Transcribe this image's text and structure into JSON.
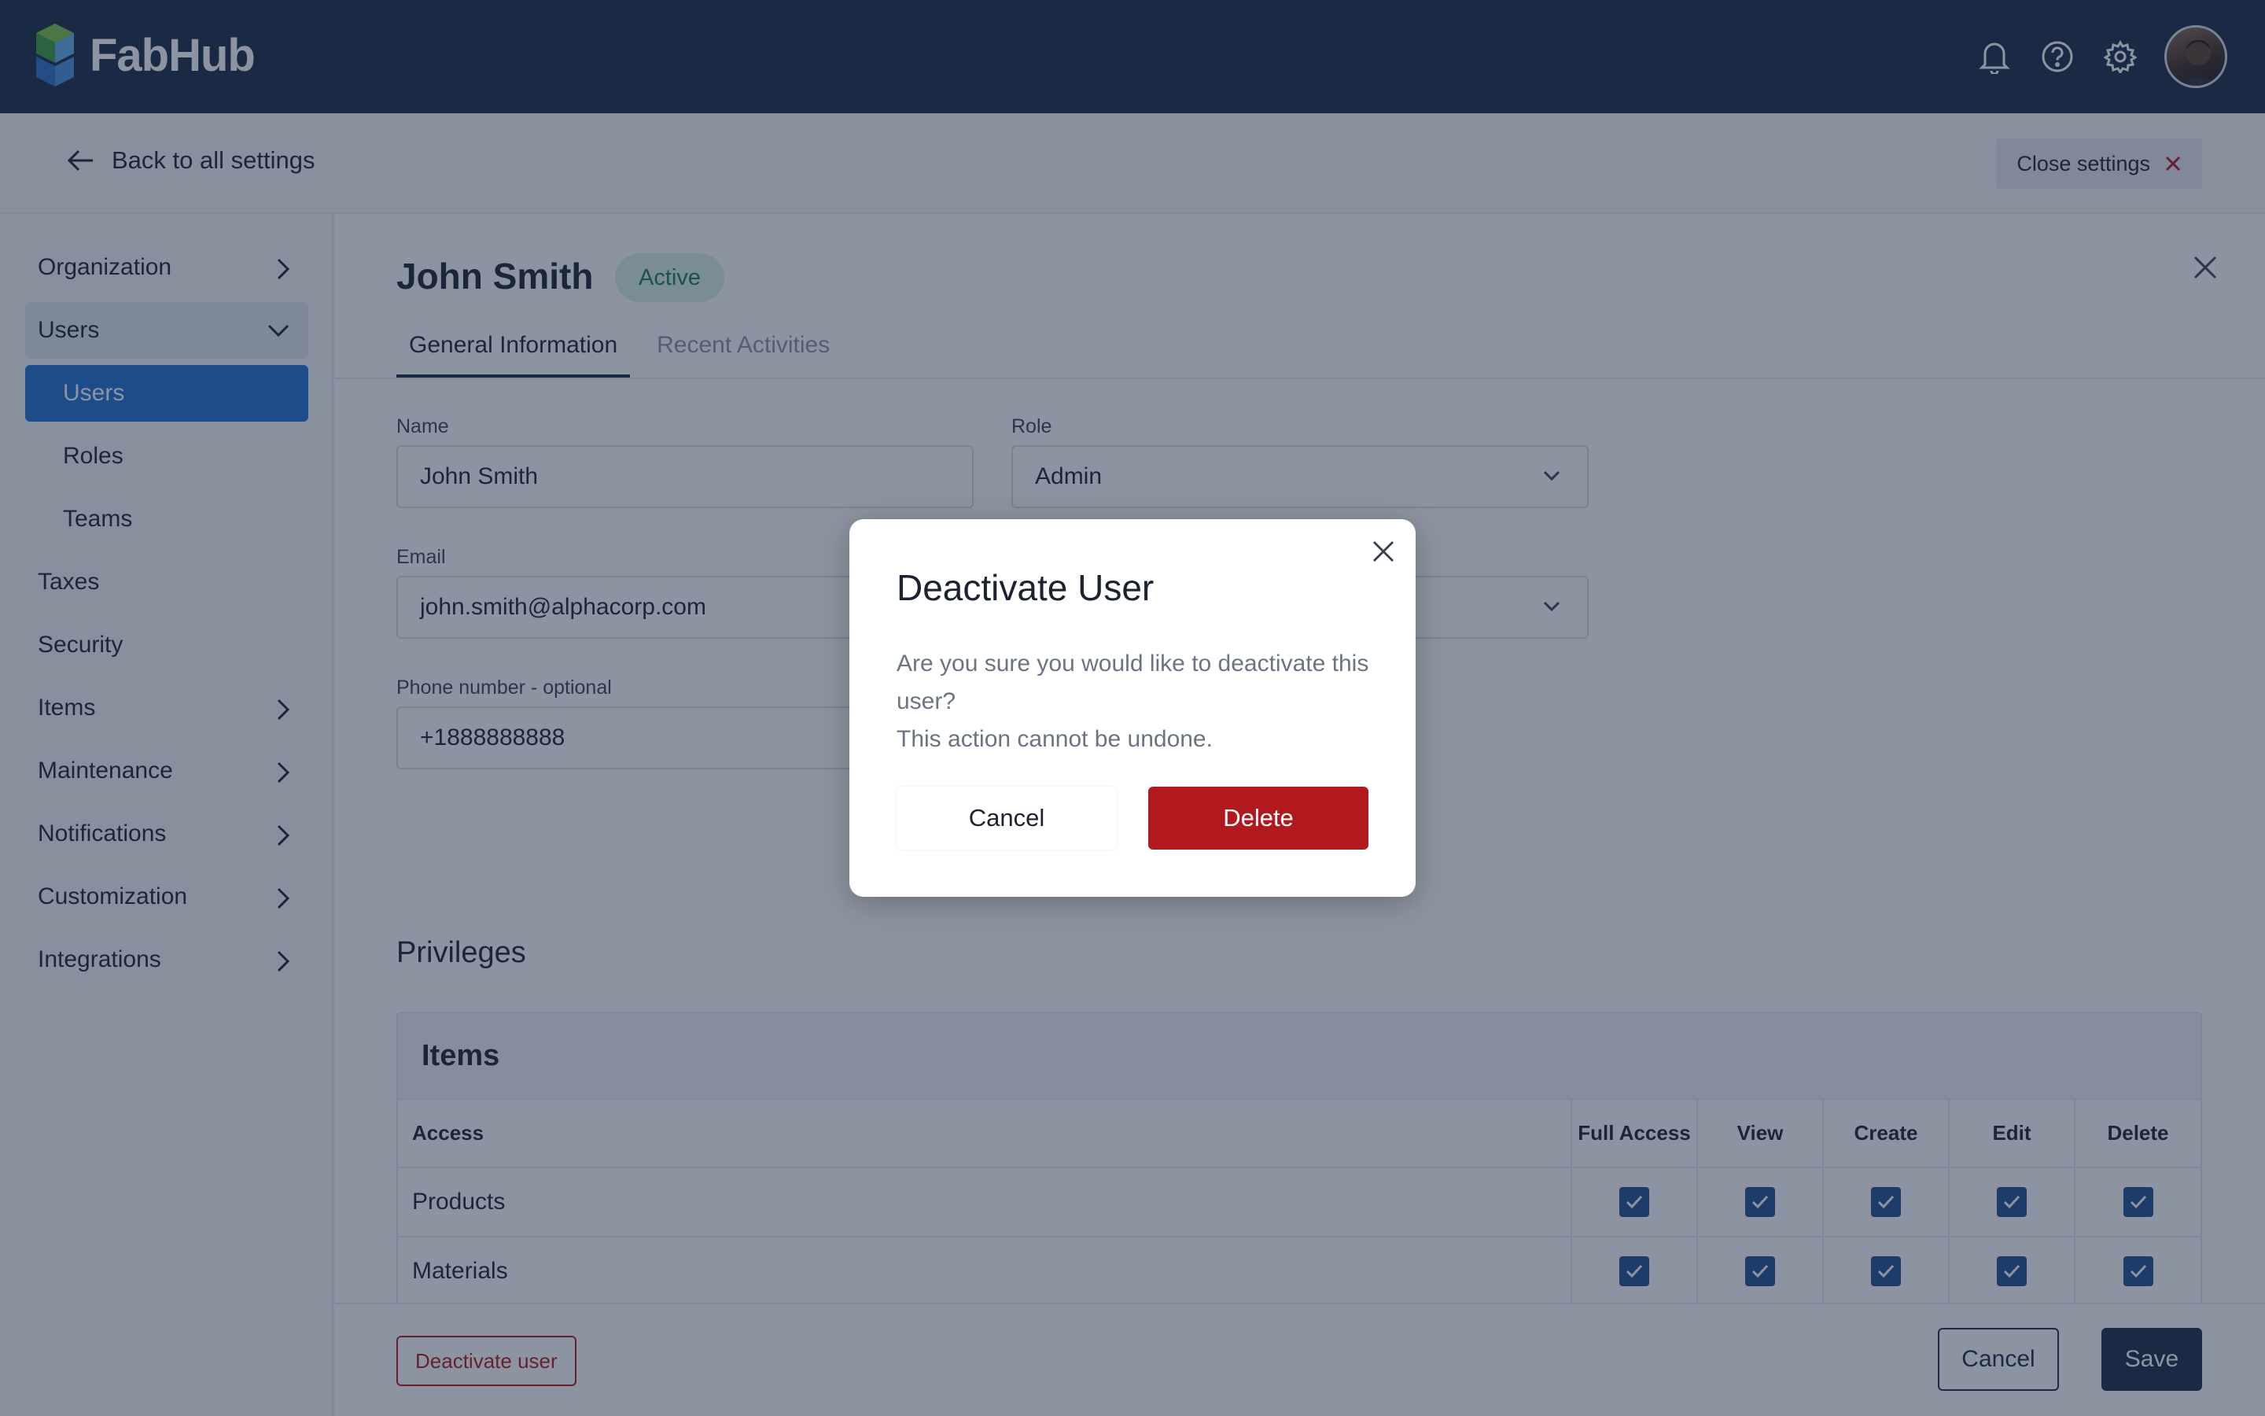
{
  "app": {
    "name": "FabHub"
  },
  "header": {
    "icons": [
      "bell-icon",
      "help-icon",
      "gear-icon"
    ],
    "back_label": "Back to all settings",
    "close_settings_label": "Close settings"
  },
  "sidebar": {
    "items": [
      {
        "label": "Organization",
        "expandable": true
      },
      {
        "label": "Users",
        "expanded": true
      },
      {
        "label": "Users",
        "sub": true,
        "selected": true
      },
      {
        "label": "Roles",
        "sub": true
      },
      {
        "label": "Teams",
        "sub": true
      },
      {
        "label": "Taxes"
      },
      {
        "label": "Security"
      },
      {
        "label": "Items",
        "expandable": true
      },
      {
        "label": "Maintenance",
        "expandable": true
      },
      {
        "label": "Notifications",
        "expandable": true
      },
      {
        "label": "Customization",
        "expandable": true
      },
      {
        "label": "Integrations",
        "expandable": true
      }
    ]
  },
  "user": {
    "name": "John Smith",
    "status": "Active"
  },
  "tabs": [
    {
      "label": "General Information",
      "active": true
    },
    {
      "label": "Recent Activities",
      "active": false
    }
  ],
  "form": {
    "name_label": "Name",
    "name_value": "John Smith",
    "role_label": "Role",
    "role_value": "Admin",
    "email_label": "Email",
    "email_value": "john.smith@alphacorp.com",
    "phone_label": "Phone number - optional",
    "phone_value": "+1888888888"
  },
  "privileges": {
    "title": "Privileges",
    "section": "Items",
    "columns": [
      "Access",
      "Full Access",
      "View",
      "Create",
      "Edit",
      "Delete"
    ],
    "rows": [
      {
        "name": "Products",
        "checks": [
          true,
          true,
          true,
          true,
          true
        ]
      },
      {
        "name": "Materials",
        "checks": [
          true,
          true,
          true,
          true,
          true
        ]
      }
    ]
  },
  "footer": {
    "deactivate_label": "Deactivate user",
    "cancel_label": "Cancel",
    "save_label": "Save"
  },
  "modal": {
    "title": "Deactivate User",
    "message_line1": "Are you sure you would like to deactivate this user?",
    "message_line2": "This action cannot be undone.",
    "cancel_label": "Cancel",
    "delete_label": "Delete"
  },
  "colors": {
    "topbar": "#1b2a44",
    "accent": "#1f6fd1",
    "danger": "#b0191e",
    "success_bg": "#d8efe5",
    "success_text": "#1f7a4e"
  }
}
